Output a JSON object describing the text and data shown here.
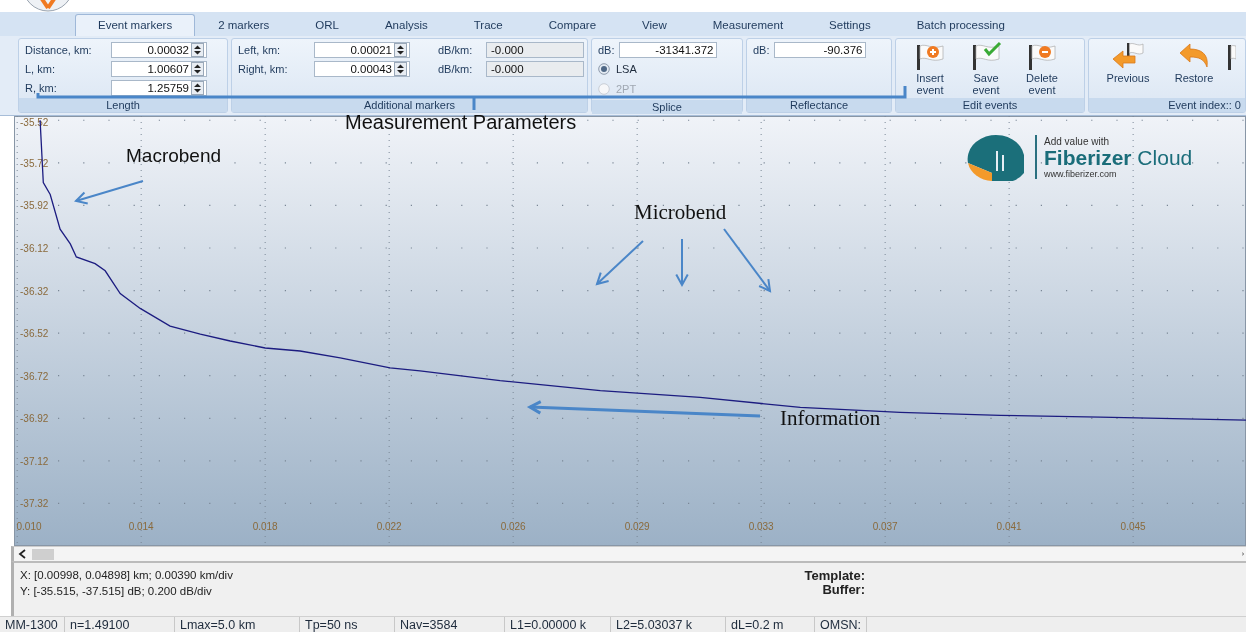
{
  "tabs": [
    {
      "label": "Event markers",
      "selected": true
    },
    {
      "label": "2 markers",
      "selected": false
    },
    {
      "label": "ORL",
      "selected": false
    },
    {
      "label": "Analysis",
      "selected": false
    },
    {
      "label": "Trace",
      "selected": false
    },
    {
      "label": "Compare",
      "selected": false
    },
    {
      "label": "View",
      "selected": false
    },
    {
      "label": "Measurement",
      "selected": false
    },
    {
      "label": "Settings",
      "selected": false
    },
    {
      "label": "Batch processing",
      "selected": false
    }
  ],
  "ribbon": {
    "length": {
      "label": "Length",
      "fields": [
        {
          "label": "Distance, km:",
          "value": "0.00032"
        },
        {
          "label": "L, km:",
          "value": "1.00607"
        },
        {
          "label": "R, km:",
          "value": "1.25759"
        }
      ]
    },
    "additional_markers": {
      "label": "Additional markers",
      "fields": [
        {
          "label": "Left, km:",
          "value": "0.00021"
        },
        {
          "label": "Right, km:",
          "value": "0.00043"
        }
      ],
      "slopes": [
        {
          "label": "dB/km:",
          "value": "-0.000",
          "disabled": true
        },
        {
          "label": "dB/km:",
          "value": "-0.000",
          "disabled": true
        }
      ]
    },
    "splice": {
      "label": "Splice",
      "field": {
        "label": "dB:",
        "value": "-31341.372"
      },
      "options": [
        {
          "label": "LSA",
          "selected": true,
          "disabled": false
        },
        {
          "label": "2PT",
          "selected": false,
          "disabled": true
        }
      ]
    },
    "reflectance": {
      "label": "Reflectance",
      "field": {
        "label": "dB:",
        "value": "-90.376"
      }
    },
    "edit_events": {
      "label": "Edit events",
      "buttons": [
        {
          "label": "Insert event",
          "kind": "insert"
        },
        {
          "label": "Save event",
          "kind": "save"
        },
        {
          "label": "Delete event",
          "kind": "delete"
        }
      ]
    },
    "event_index": {
      "label": "Event index:: 0",
      "buttons": [
        {
          "label": "Previous",
          "kind": "previous"
        },
        {
          "label": "Restore",
          "kind": "restore"
        },
        {
          "kind": "flag"
        }
      ]
    }
  },
  "chart": {
    "logo": {
      "tagline": "Add value with",
      "name": "**Fiberizer** Cloud",
      "url": "www.fiberizer.com"
    },
    "chart_data": {
      "type": "line",
      "grid": true,
      "xlim": [
        0.00988,
        0.04863
      ],
      "ylim": [
        -37.515,
        -35.495
      ],
      "xticks": [
        {
          "value": 0.00998,
          "label": "0.010"
        },
        {
          "value": 0.01388,
          "label": "0.014"
        },
        {
          "value": 0.01778,
          "label": "0.018"
        },
        {
          "value": 0.02168,
          "label": "0.022"
        },
        {
          "value": 0.02558,
          "label": "0.026"
        },
        {
          "value": 0.02948,
          "label": "0.029"
        },
        {
          "value": 0.03338,
          "label": "0.033"
        },
        {
          "value": 0.03728,
          "label": "0.037"
        },
        {
          "value": 0.04118,
          "label": "0.041"
        },
        {
          "value": 0.04508,
          "label": "0.045"
        }
      ],
      "yticks": [
        {
          "value": -35.515,
          "label": "-35.52"
        },
        {
          "value": -35.715,
          "label": "-35.72"
        },
        {
          "value": -35.915,
          "label": "-35.92"
        },
        {
          "value": -36.115,
          "label": "-36.12"
        },
        {
          "value": -36.315,
          "label": "-36.32"
        },
        {
          "value": -36.515,
          "label": "-36.52"
        },
        {
          "value": -36.715,
          "label": "-36.72"
        },
        {
          "value": -36.915,
          "label": "-36.92"
        },
        {
          "value": -37.115,
          "label": "-37.12"
        },
        {
          "value": -37.315,
          "label": "-37.32"
        }
      ],
      "x": [
        0.0107,
        0.0108,
        0.01102,
        0.01133,
        0.01165,
        0.01184,
        0.01243,
        0.01275,
        0.01322,
        0.01385,
        0.01479,
        0.01574,
        0.01668,
        0.01778,
        0.01888,
        0.02014,
        0.02171,
        0.02265,
        0.02517,
        0.02832,
        0.03146,
        0.03461,
        0.03775,
        0.0409,
        0.04404,
        0.04863
      ],
      "series": [
        {
          "color": "#1c1c80",
          "values": [
            -35.515,
            -35.808,
            -35.864,
            -36.027,
            -36.096,
            -36.157,
            -36.189,
            -36.222,
            -36.329,
            -36.399,
            -36.482,
            -36.52,
            -36.552,
            -36.585,
            -36.599,
            -36.631,
            -36.678,
            -36.692,
            -36.738,
            -36.785,
            -36.817,
            -36.864,
            -36.887,
            -36.901,
            -36.91,
            -36.924
          ]
        }
      ]
    }
  },
  "info": {
    "x_range": "X: [0.00998, 0.04898] km; 0.00390 km/div",
    "y_range": "Y: [-35.515, -37.515] dB; 0.200 dB/div",
    "template": "Template:",
    "buffer": "Buffer:"
  },
  "status_bar": [
    "MM-1300",
    "n=1.49100",
    "Lmax=5.0 km",
    "Tp=50 ns",
    "Nav=3584",
    "L1=0.00000 k",
    "L2=5.03037 k",
    "dL=0.2 m",
    "OMSN:"
  ],
  "annotations": [
    {
      "text": "Measurement Parameters"
    },
    {
      "text": "Macrobend"
    },
    {
      "text": "Microbend"
    },
    {
      "text": "Information"
    }
  ]
}
